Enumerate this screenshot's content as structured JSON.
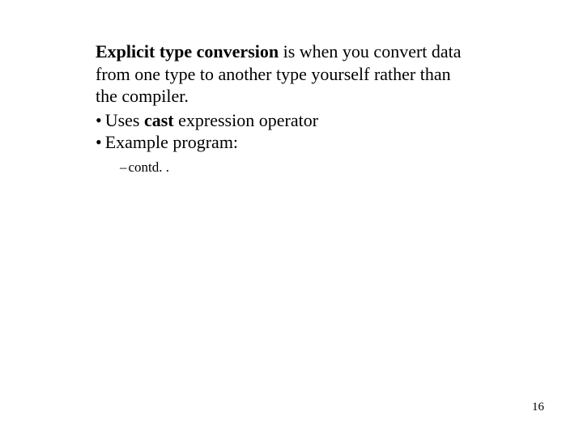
{
  "para": {
    "term": "Explicit type conversion",
    "rest": "  is when you convert data from one type to another type yourself rather than the compiler."
  },
  "bullets": {
    "b1_prefix": "Uses ",
    "b1_strong": "cast",
    "b1_suffix": " expression operator",
    "b2": "Example program:"
  },
  "sub": {
    "s1": "contd. ."
  },
  "page": "16"
}
